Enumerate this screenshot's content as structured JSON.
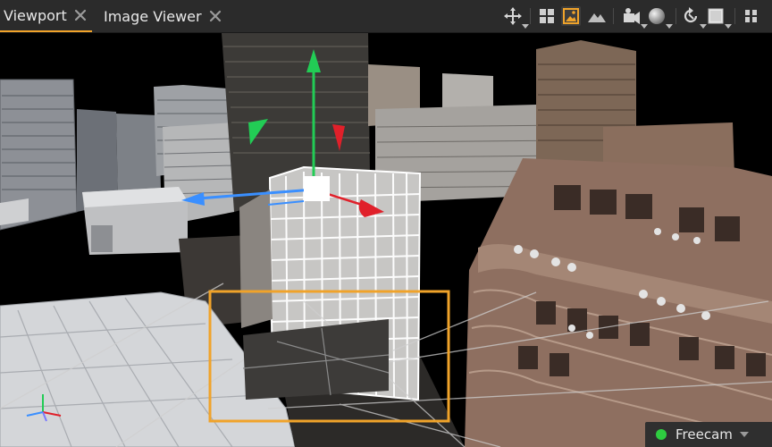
{
  "tabs": [
    {
      "label": "Viewport",
      "active": true
    },
    {
      "label": "Image Viewer",
      "active": false
    }
  ],
  "toolbar": {
    "icons": [
      "transform-gizmo-icon",
      "grid-layout-icon",
      "image-overlay-icon",
      "terrain-icon",
      "light-icon",
      "sphere-shading-icon",
      "rotate-view-icon",
      "box-render-icon",
      "panel-split-icon"
    ]
  },
  "status": {
    "camera_mode": "Freecam",
    "indicator_color": "#2ecc40"
  },
  "colors": {
    "accent": "#f0a32a",
    "selection_frame": "#f0a32a",
    "gizmo_y": "#22cc55",
    "gizmo_x": "#3a8fff",
    "gizmo_z": "#e0202a"
  }
}
